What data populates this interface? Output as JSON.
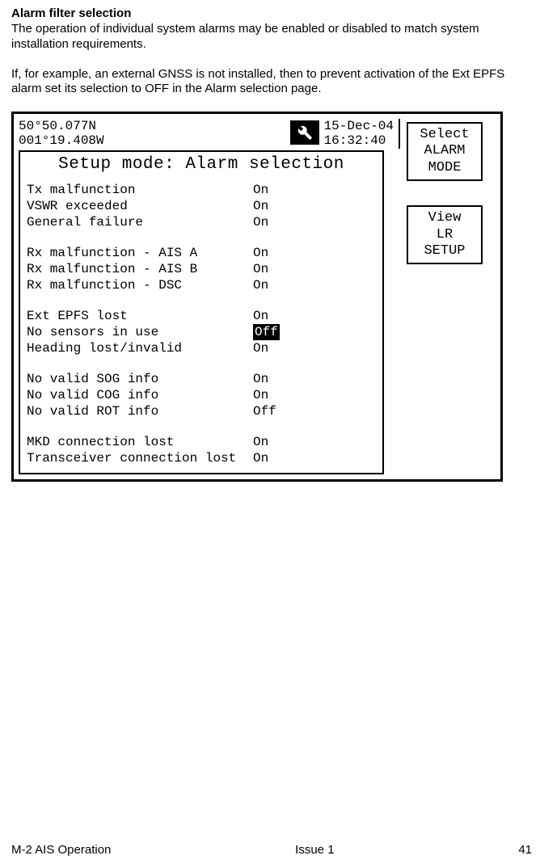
{
  "heading": "Alarm filter selection",
  "para1": "The operation of individual system alarms may be enabled or disabled to match system installation requirements.",
  "para2": "If, for example, an external GNSS is not installed, then to prevent activation of the Ext EPFS alarm set its selection to OFF in the Alarm selection page.",
  "coords": {
    "lat": "50°50.077N",
    "lon": "001°19.408W"
  },
  "datetime": {
    "date": "15-Dec-04",
    "time": "16:32:40"
  },
  "screen_title": "Setup mode: Alarm selection",
  "alarms": {
    "g1": [
      {
        "label": "Tx malfunction",
        "value": "On"
      },
      {
        "label": "VSWR exceeded",
        "value": "On"
      },
      {
        "label": "General failure",
        "value": "On"
      }
    ],
    "g2": [
      {
        "label": "Rx malfunction - AIS A",
        "value": "On"
      },
      {
        "label": "Rx malfunction - AIS B",
        "value": "On"
      },
      {
        "label": "Rx malfunction - DSC",
        "value": "On"
      }
    ],
    "g3": [
      {
        "label": "Ext EPFS lost",
        "value": "On"
      },
      {
        "label": "No sensors in use",
        "value": "Off",
        "selected": true
      },
      {
        "label": "Heading lost/invalid",
        "value": "On"
      }
    ],
    "g4": [
      {
        "label": "No valid SOG info",
        "value": "On"
      },
      {
        "label": "No valid COG info",
        "value": "On"
      },
      {
        "label": "No valid ROT info",
        "value": "Off"
      }
    ],
    "g5": [
      {
        "label": "MKD connection lost",
        "value": "On"
      },
      {
        "label": "Transceiver connection lost",
        "value": "On"
      }
    ]
  },
  "softkeys": {
    "k1": {
      "l1": "Select",
      "l2": "ALARM",
      "l3": "MODE"
    },
    "k2": {
      "l1": "View",
      "l2": "LR",
      "l3": "SETUP"
    }
  },
  "footer": {
    "left": "M-2 AIS Operation",
    "center": "Issue 1",
    "right": "41"
  }
}
